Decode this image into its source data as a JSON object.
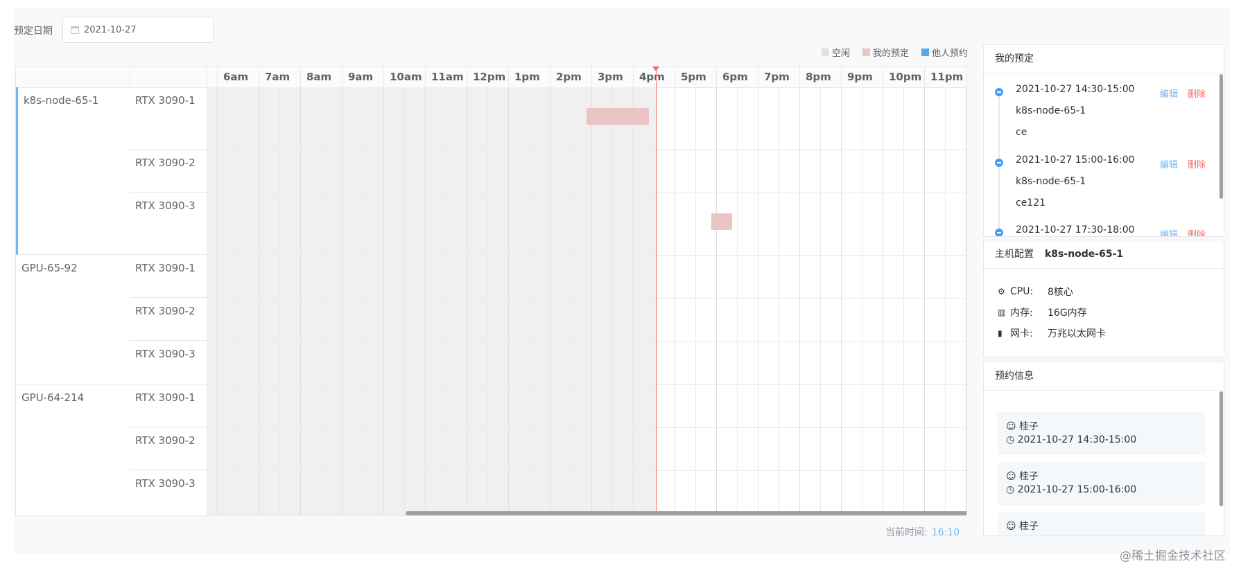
{
  "date_picker": {
    "label": "预定日期",
    "value": "2021-10-27"
  },
  "legend": [
    {
      "label": "空闲",
      "color": "#e0e0e0"
    },
    {
      "label": "我的预定",
      "color": "#ecc4c4"
    },
    {
      "label": "他人预约",
      "color": "#5aa7ea"
    }
  ],
  "hours": [
    "6am",
    "7am",
    "8am",
    "9am",
    "10am",
    "11am",
    "12pm",
    "1pm",
    "2pm",
    "3pm",
    "4pm",
    "5pm",
    "6pm",
    "7pm",
    "8pm",
    "9pm",
    "10pm",
    "11pm"
  ],
  "hosts": [
    {
      "name": "k8s-node-65-1",
      "cards": [
        "RTX 3090-1",
        "RTX 3090-2",
        "RTX 3090-3"
      ]
    },
    {
      "name": "GPU-65-92",
      "cards": [
        "RTX 3090-1",
        "RTX 3090-2",
        "RTX 3090-3"
      ]
    },
    {
      "name": "GPU-64-214",
      "cards": [
        "RTX 3090-1",
        "RTX 3090-2",
        "RTX 3090-3"
      ]
    }
  ],
  "current_time": {
    "label": "当前时间:",
    "value": "16:10"
  },
  "my_reservations": {
    "title": "我的预定",
    "edit_label": "编辑",
    "delete_label": "删除",
    "items": [
      {
        "time": "2021-10-27 14:30-15:00",
        "host": "k8s-node-65-1",
        "note": "ce"
      },
      {
        "time": "2021-10-27 15:00-16:00",
        "host": "k8s-node-65-1",
        "note": "ce121"
      },
      {
        "time": "2021-10-27 17:30-18:00"
      }
    ]
  },
  "host_config": {
    "title": "主机配置",
    "host": "k8s-node-65-1",
    "rows": [
      {
        "icon": "cpu-icon",
        "key": "CPU:",
        "value": "8核心"
      },
      {
        "icon": "memory-icon",
        "key": "内存:",
        "value": "16G内存"
      },
      {
        "icon": "network-icon",
        "key": "网卡:",
        "value": "万兆以太网卡"
      }
    ]
  },
  "reservation_info": {
    "title": "预约信息",
    "items": [
      {
        "user": "桂子",
        "time": "2021-10-27 14:30-15:00"
      },
      {
        "user": "桂子",
        "time": "2021-10-27 15:00-16:00"
      },
      {
        "user": "桂子"
      }
    ]
  },
  "watermark": "@稀土掘金技术社区"
}
